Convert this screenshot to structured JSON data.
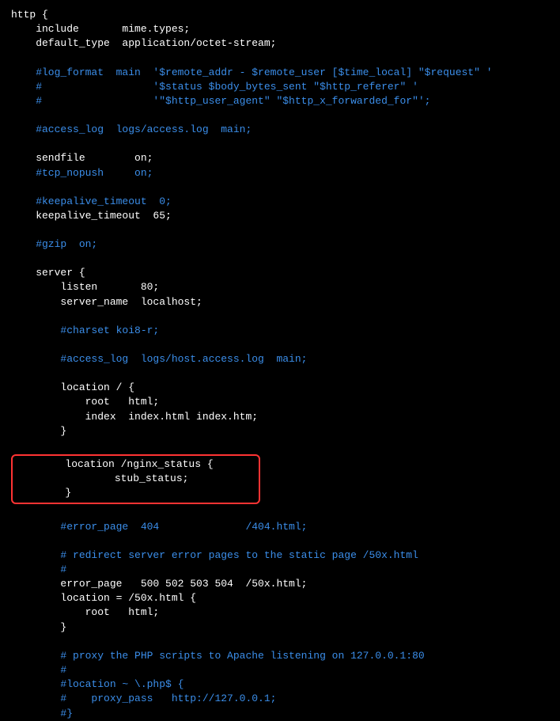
{
  "code": {
    "l01": "http {",
    "l02": "    include       mime.types;",
    "l03": "    default_type  application/octet-stream;",
    "l04": "",
    "l05": "    #log_format  main  '$remote_addr - $remote_user [$time_local] \"$request\" '",
    "l06": "    #                  '$status $body_bytes_sent \"$http_referer\" '",
    "l07": "    #                  '\"$http_user_agent\" \"$http_x_forwarded_for\"';",
    "l08": "",
    "l09": "    #access_log  logs/access.log  main;",
    "l10": "",
    "l11": "    sendfile        on;",
    "l12": "    #tcp_nopush     on;",
    "l13": "",
    "l14": "    #keepalive_timeout  0;",
    "l15": "    keepalive_timeout  65;",
    "l16": "",
    "l17": "    #gzip  on;",
    "l18": "",
    "l19": "    server {",
    "l20": "        listen       80;",
    "l21": "        server_name  localhost;",
    "l22": "",
    "l23": "        #charset koi8-r;",
    "l24": "",
    "l25": "        #access_log  logs/host.access.log  main;",
    "l26": "",
    "l27": "        location / {",
    "l28": "            root   html;",
    "l29": "            index  index.html index.htm;",
    "l30": "        }",
    "l31": "",
    "hb1": "        location /nginx_status {",
    "hb2": "                stub_status;",
    "hb3": "        }",
    "l35": "",
    "l36": "        #error_page  404              /404.html;",
    "l37": "",
    "l38": "        # redirect server error pages to the static page /50x.html",
    "l39": "        #",
    "l40": "        error_page   500 502 503 504  /50x.html;",
    "l41": "        location = /50x.html {",
    "l42": "            root   html;",
    "l43": "        }",
    "l44": "",
    "l45": "        # proxy the PHP scripts to Apache listening on 127.0.0.1:80",
    "l46": "        #",
    "l47": "        #location ~ \\.php$ {",
    "l48": "        #    proxy_pass   http://127.0.0.1;",
    "l49": "        #}"
  }
}
